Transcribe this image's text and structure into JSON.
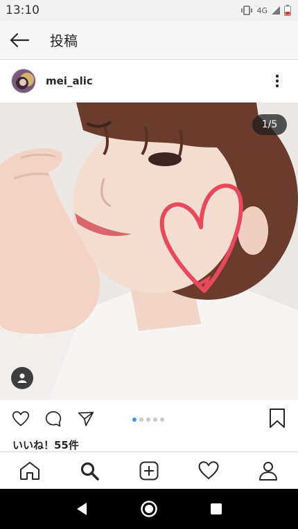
{
  "status_bar": {
    "time": "13:10",
    "network": "4G"
  },
  "header": {
    "title": "投稿"
  },
  "post": {
    "username": "mei_alic",
    "image_counter": "1/5",
    "carousel": {
      "total": 5,
      "active_index": 0
    },
    "likes_text": "いいね！55件"
  },
  "icons": {
    "back": "arrow-left-icon",
    "more": "more-vertical-icon",
    "like": "heart-outline-icon",
    "comment": "comment-icon",
    "share": "paper-plane-icon",
    "save": "bookmark-icon",
    "tag": "person-tag-icon"
  },
  "nav": {
    "items": [
      "home-icon",
      "search-icon",
      "add-post-icon",
      "activity-heart-icon",
      "profile-icon"
    ],
    "active": "search-icon"
  },
  "colors": {
    "accent": "#3897f0",
    "heart_doodle": "#e8495a",
    "text": "#262626"
  }
}
